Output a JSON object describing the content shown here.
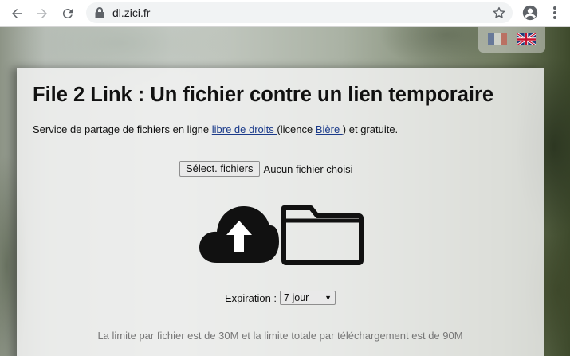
{
  "browser": {
    "url": "dl.zici.fr",
    "icons": {
      "back": "arrow-left-icon",
      "forward": "arrow-right-icon",
      "reload": "reload-icon",
      "lock": "lock-icon",
      "bookmark": "star-icon",
      "profile": "account-circle-icon",
      "menu": "kebab-menu-icon"
    }
  },
  "languages": [
    {
      "code": "fr",
      "icon": "flag-fr-icon"
    },
    {
      "code": "en",
      "icon": "flag-uk-icon"
    }
  ],
  "page": {
    "title": "File 2 Link : Un fichier contre un lien temporaire",
    "intro": {
      "before": "Service de partage de fichiers en ligne ",
      "link1": "libre de droits ",
      "middle": "(licence ",
      "link2": "Bière ",
      "after": ") et gratuite."
    },
    "file_button": "Sélect. fichiers",
    "file_status": "Aucun fichier choisi",
    "upload_icons": [
      "cloud-upload-icon",
      "folder-icon"
    ],
    "expiration_label": "Expiration : ",
    "expiration_value": "7 jour",
    "limits": "La limite par fichier est de 30M et la limite totale par téléchargement est de 90M"
  },
  "colors": {
    "link": "#1a3a8a",
    "muted_text": "#777777",
    "title": "#111111"
  }
}
